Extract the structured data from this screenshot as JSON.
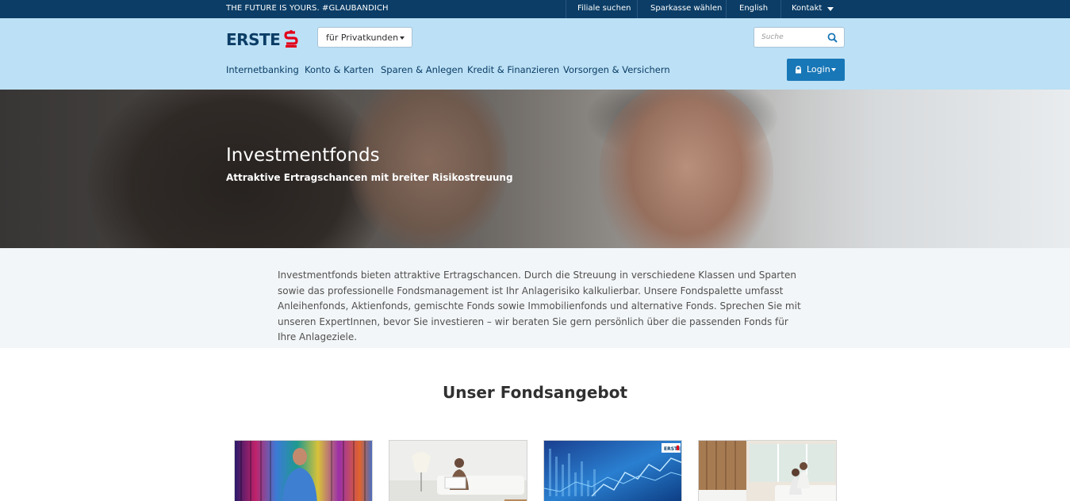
{
  "topbar": {
    "slogan": "THE FUTURE IS YOURS. #GLAUBANDICH",
    "links": [
      "Filiale suchen",
      "Sparkasse wählen",
      "English",
      "Kontakt"
    ]
  },
  "header": {
    "logo_text": "ERSTE",
    "segment_select": "für  Privatkunden",
    "search_placeholder": "Suche",
    "nav": [
      "Internetbanking",
      "Konto & Karten",
      "Sparen & Anlegen",
      "Kredit & Finanzieren",
      "Vorsorgen & Versichern"
    ],
    "login_label": "Login",
    "colors": {
      "brand_navy": "#0b3d66",
      "header_bg": "#bce0f5",
      "login_blue": "#1877b7",
      "logo_red": "#e2001a"
    }
  },
  "hero": {
    "title": "Investmentfonds",
    "subtitle": "Attraktive Ertragschancen mit breiter Risikostreuung"
  },
  "intro": {
    "text": "Investmentfonds bieten attraktive Ertragschancen. Durch die Streuung in verschiedene Klassen und Sparten sowie das professionelle Fondsmanagement ist Ihr Anlagerisiko kalkulierbar. Unsere Fondspalette umfasst Anleihenfonds, Aktienfonds, gemischte Fonds sowie Immobilienfonds und alternative Fonds. Sprechen Sie mit unseren ExpertInnen, bevor Sie investieren – wir beraten Sie gern persönlich über die passenden Fonds für Ihre Anlageziele."
  },
  "offer": {
    "title": "Unser Fondsangebot",
    "cards": [
      {
        "image": "woman-colorful-lights-image"
      },
      {
        "image": "man-reading-newspaper-image"
      },
      {
        "image": "stock-chart-screens-image",
        "logo_text": "ERSTE"
      },
      {
        "image": "couple-living-room-image"
      }
    ]
  }
}
